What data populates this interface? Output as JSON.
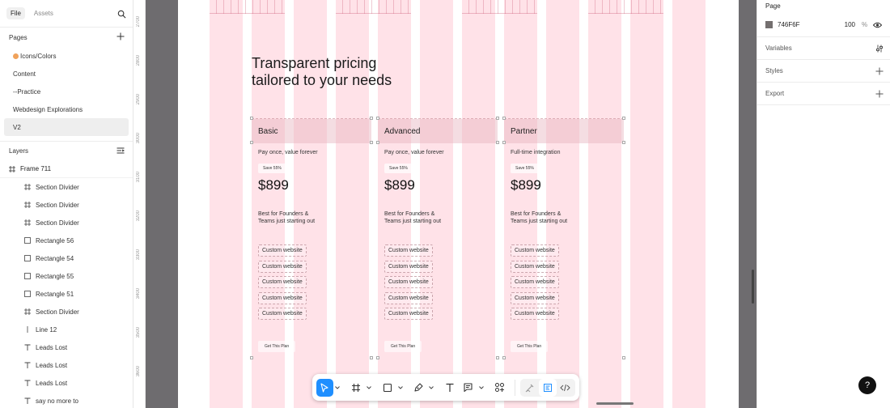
{
  "left_panel": {
    "tabs": [
      "File",
      "Assets"
    ],
    "pages_label": "Pages",
    "pages": [
      "Icons/Colors",
      "Content",
      "--Practice",
      "Webdesign Explorations",
      "V2"
    ],
    "layers_label": "Layers",
    "root_layer": "Frame 711",
    "layers": [
      {
        "name": "Section Divider",
        "icon": "frame-icon"
      },
      {
        "name": "Section Divider",
        "icon": "frame-icon"
      },
      {
        "name": "Section Divider",
        "icon": "frame-icon"
      },
      {
        "name": "Rectangle 56",
        "icon": "rectangle-icon"
      },
      {
        "name": "Rectangle 54",
        "icon": "rectangle-icon"
      },
      {
        "name": "Rectangle 55",
        "icon": "rectangle-icon"
      },
      {
        "name": "Rectangle 51",
        "icon": "rectangle-icon"
      },
      {
        "name": "Section Divider",
        "icon": "frame-icon"
      },
      {
        "name": "Line 12",
        "icon": "line-icon"
      },
      {
        "name": "Leads Lost",
        "icon": "text-icon"
      },
      {
        "name": "Leads Lost",
        "icon": "text-icon"
      },
      {
        "name": "Leads Lost",
        "icon": "text-icon"
      },
      {
        "name": "say no more to",
        "icon": "text-icon"
      }
    ]
  },
  "ruler": [
    "2700",
    "2800",
    "2900",
    "3000",
    "3100",
    "3200",
    "3300",
    "3400",
    "3500",
    "3600"
  ],
  "canvas": {
    "headline": "Transparent pricing\ntailored to your needs",
    "cards": [
      {
        "title": "Basic",
        "tagline": "Pay once, value forever",
        "badge": "Save 55%",
        "price": "$899",
        "desc": "Best for Founders &\nTeams just starting out",
        "features": [
          "Custom website",
          "Custom website",
          "Custom website",
          "Custom website",
          "Custom website"
        ],
        "cta": "Get This Plan"
      },
      {
        "title": "Advanced",
        "tagline": "Pay once, value forever",
        "badge": "Save 55%",
        "price": "$899",
        "desc": "Best for Founders &\nTeams just starting out",
        "features": [
          "Custom website",
          "Custom website",
          "Custom website",
          "Custom website",
          "Custom website"
        ],
        "cta": "Get This Plan"
      },
      {
        "title": "Partner",
        "tagline": "Full-time integration",
        "badge": "Save 55%",
        "price": "$899",
        "desc": "Best for Founders &\nTeams just starting out",
        "features": [
          "Custom website",
          "Custom website",
          "Custom website",
          "Custom website",
          "Custom website"
        ],
        "cta": "Get This Plan"
      }
    ]
  },
  "right_panel": {
    "page_label": "Page",
    "fill_hex": "746F6F",
    "fill_opacity": "100",
    "fill_unit": "%",
    "rows": [
      "Variables",
      "Styles",
      "Export"
    ]
  },
  "help_label": "?",
  "colors": {
    "accent": "#1f8fff",
    "page_fill": "#746f6f",
    "grid_col": "#ffd6de"
  }
}
